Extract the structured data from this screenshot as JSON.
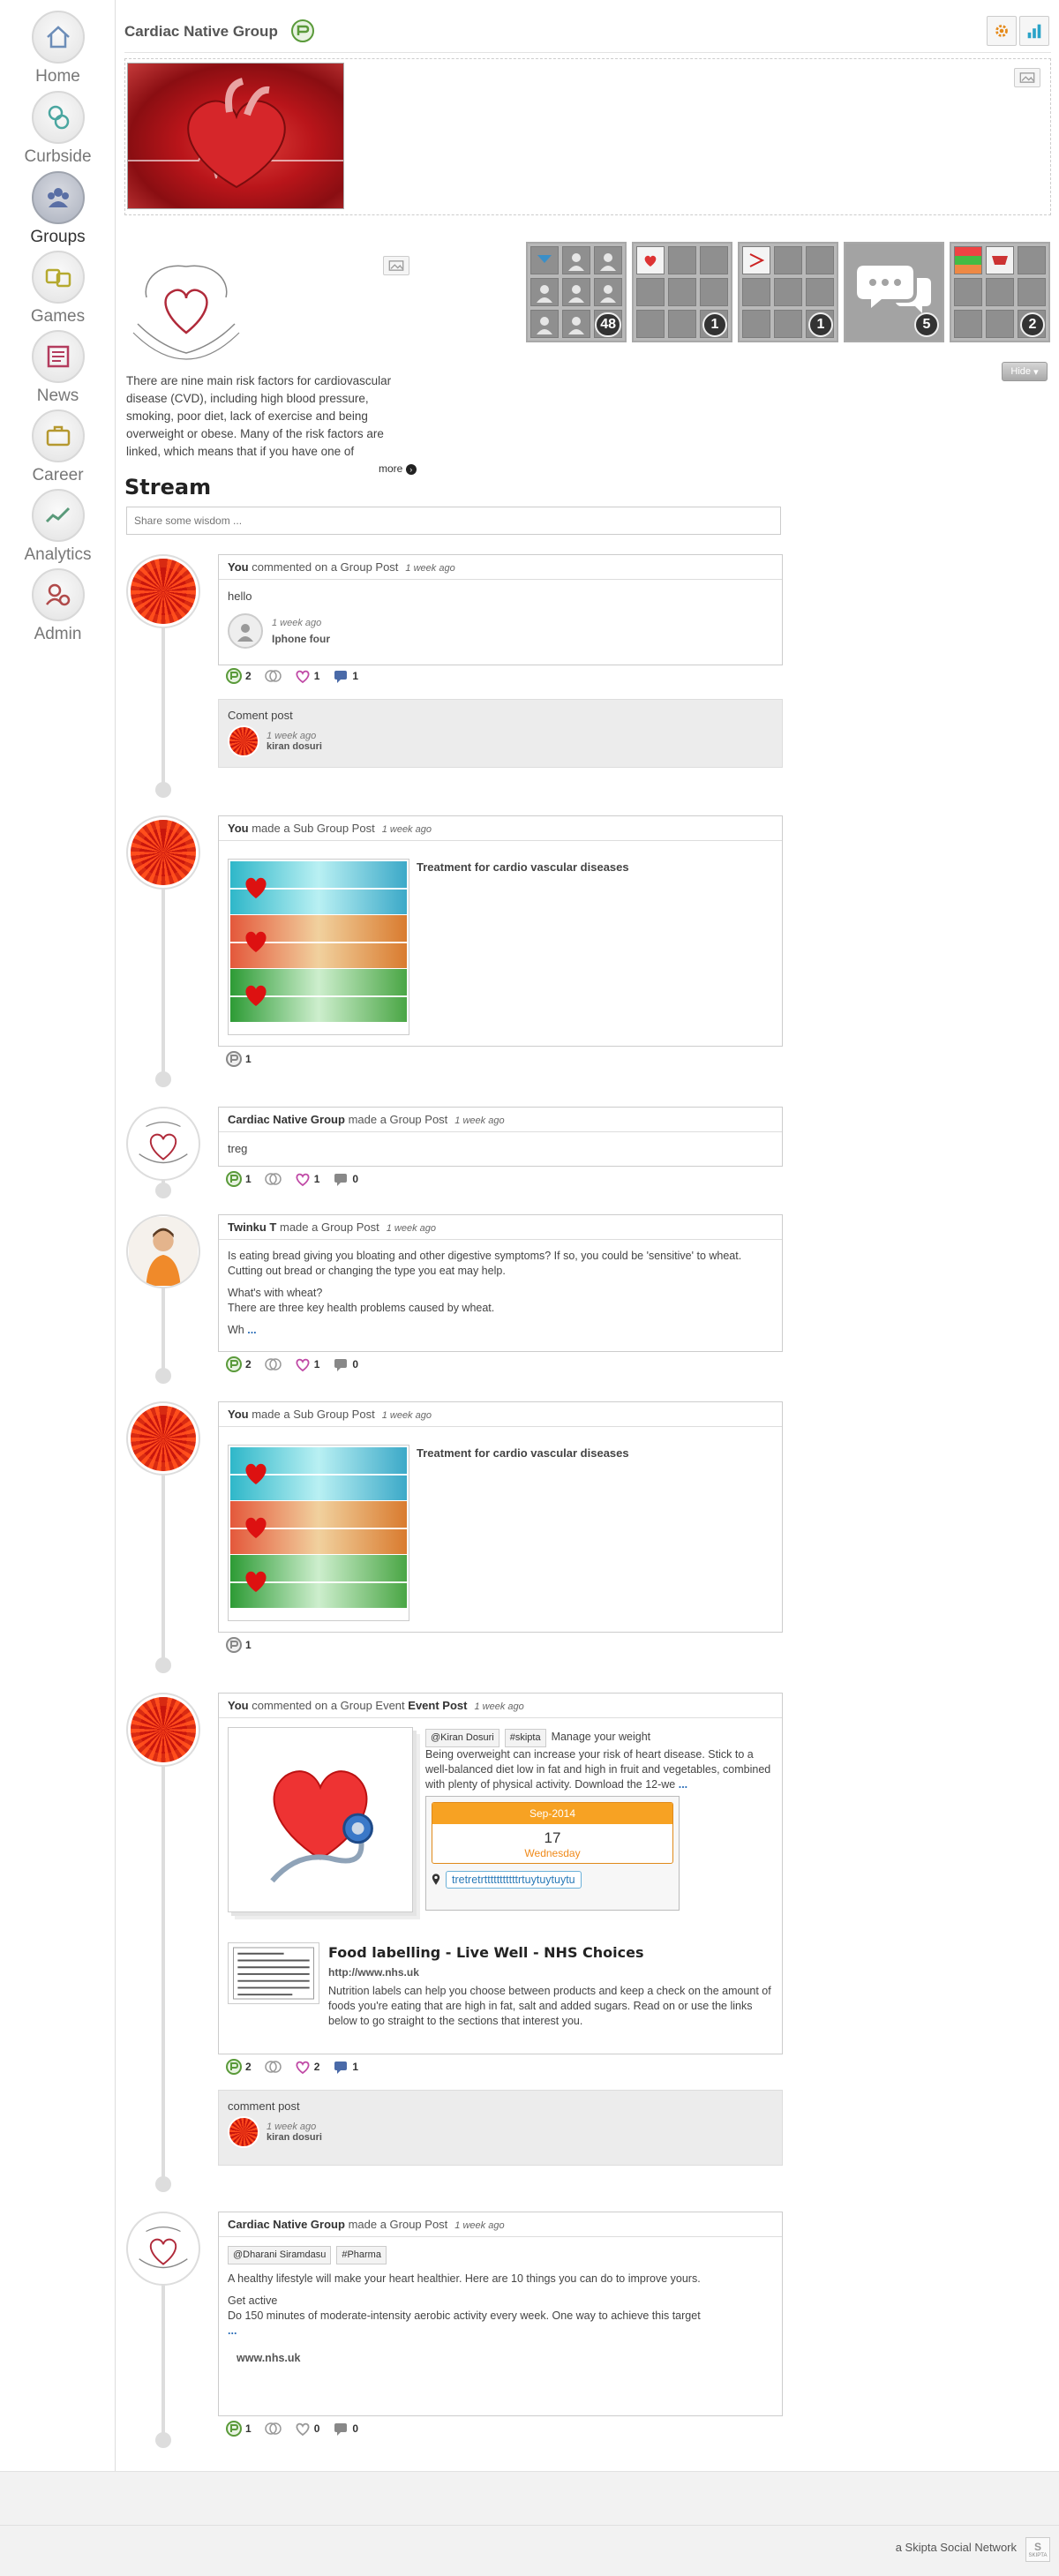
{
  "sidebar": {
    "items": [
      {
        "label": "Home"
      },
      {
        "label": "Curbside"
      },
      {
        "label": "Groups"
      },
      {
        "label": "Games"
      },
      {
        "label": "News"
      },
      {
        "label": "Career"
      },
      {
        "label": "Analytics"
      },
      {
        "label": "Admin"
      }
    ]
  },
  "header": {
    "title": "Cardiac Native Group"
  },
  "about": {
    "text": "There are nine main risk factors for cardiovascular disease (CVD), including high blood pressure, smoking, poor diet, lack of exercise and being overweight or obese. Many of the risk factors are linked, which means that if you have one of",
    "more": "more"
  },
  "tiles": [
    {
      "count": "48"
    },
    {
      "count": "1"
    },
    {
      "count": "1"
    },
    {
      "count": "5"
    },
    {
      "count": "2"
    }
  ],
  "hide_label": "Hide",
  "stream": {
    "title": "Stream",
    "placeholder": "Share some wisdom ..."
  },
  "posts": [
    {
      "actor": "You",
      "action": "commented on a Group Post",
      "time": "1 week ago",
      "body": "hello",
      "sub_time": "1 week ago",
      "sub_name": "Iphone four",
      "likes": "2",
      "hearts": "1",
      "comments": "1",
      "comment": {
        "text": "Coment post",
        "time": "1 week ago",
        "name": "kiran dosuri"
      }
    },
    {
      "actor": "You",
      "action": "made a Sub Group Post",
      "time": "1 week ago",
      "title": "Treatment for cardio vascular diseases",
      "likes": "1"
    },
    {
      "actor": "Cardiac Native Group",
      "action": "made a Group Post",
      "time": "1 week ago",
      "body": "treg",
      "likes": "1",
      "hearts": "1",
      "comments": "0"
    },
    {
      "actor": "Twinku T",
      "action": "made a Group Post",
      "time": "1 week ago",
      "body1": "Is eating bread giving you bloating and other digestive symptoms? If so, you could be 'sensitive' to wheat. Cutting out bread or changing the type you eat may help.",
      "body2": "What's with wheat?",
      "body3": "There are three key health problems caused by wheat.",
      "body4": "Wh",
      "dots": "...",
      "likes": "2",
      "hearts": "1",
      "comments": "0"
    },
    {
      "actor": "You",
      "action": "made a Sub Group Post",
      "time": "1 week ago",
      "title": "Treatment for cardio vascular diseases",
      "likes": "1"
    },
    {
      "actor": "You",
      "action": "commented on a Group Event",
      "action_bold": "Event Post",
      "time": "1 week ago",
      "tag1": "@Kiran Dosuri",
      "tag2": "#skipta",
      "tag_text": "Manage your weight",
      "body": "Being overweight can increase your risk of heart disease. Stick to a well-balanced diet low in fat and high in fruit and vegetables, combined with plenty of physical activity. Download the 12-we",
      "dots": "...",
      "event": {
        "month": "Sep-2014",
        "day": "17",
        "weekday": "Wednesday",
        "location": "tretretrtttttttttttrtuytuytuytu"
      },
      "link": {
        "title": "Food labelling - Live Well - NHS Choices",
        "url": "http://www.nhs.uk",
        "desc": "Nutrition labels can help you choose between products and keep a check on the amount of foods you're eating that are high in fat, salt and added sugars. Read on or use the links below to go straight to the sections that interest you."
      },
      "likes": "2",
      "hearts": "2",
      "comments": "1",
      "comment": {
        "text": "comment post",
        "time": "1 week ago",
        "name": "kiran dosuri"
      }
    },
    {
      "actor": "Cardiac Native Group",
      "action": "made a Group Post",
      "time": "1 week ago",
      "tag1": "@Dharani Siramdasu",
      "tag2": "#Pharma",
      "body1": "A healthy lifestyle will make your heart healthier. Here are 10 things you can do to improve yours.",
      "body2": "Get active",
      "body3": "Do 150 minutes of moderate-intensity aerobic activity every week. One way to achieve this target",
      "dots": "...",
      "site": "www.nhs.uk",
      "likes": "1",
      "hearts": "0",
      "comments": "0"
    }
  ],
  "footer": {
    "text": "a Skipta Social Network",
    "brand": "SKIPTA"
  }
}
